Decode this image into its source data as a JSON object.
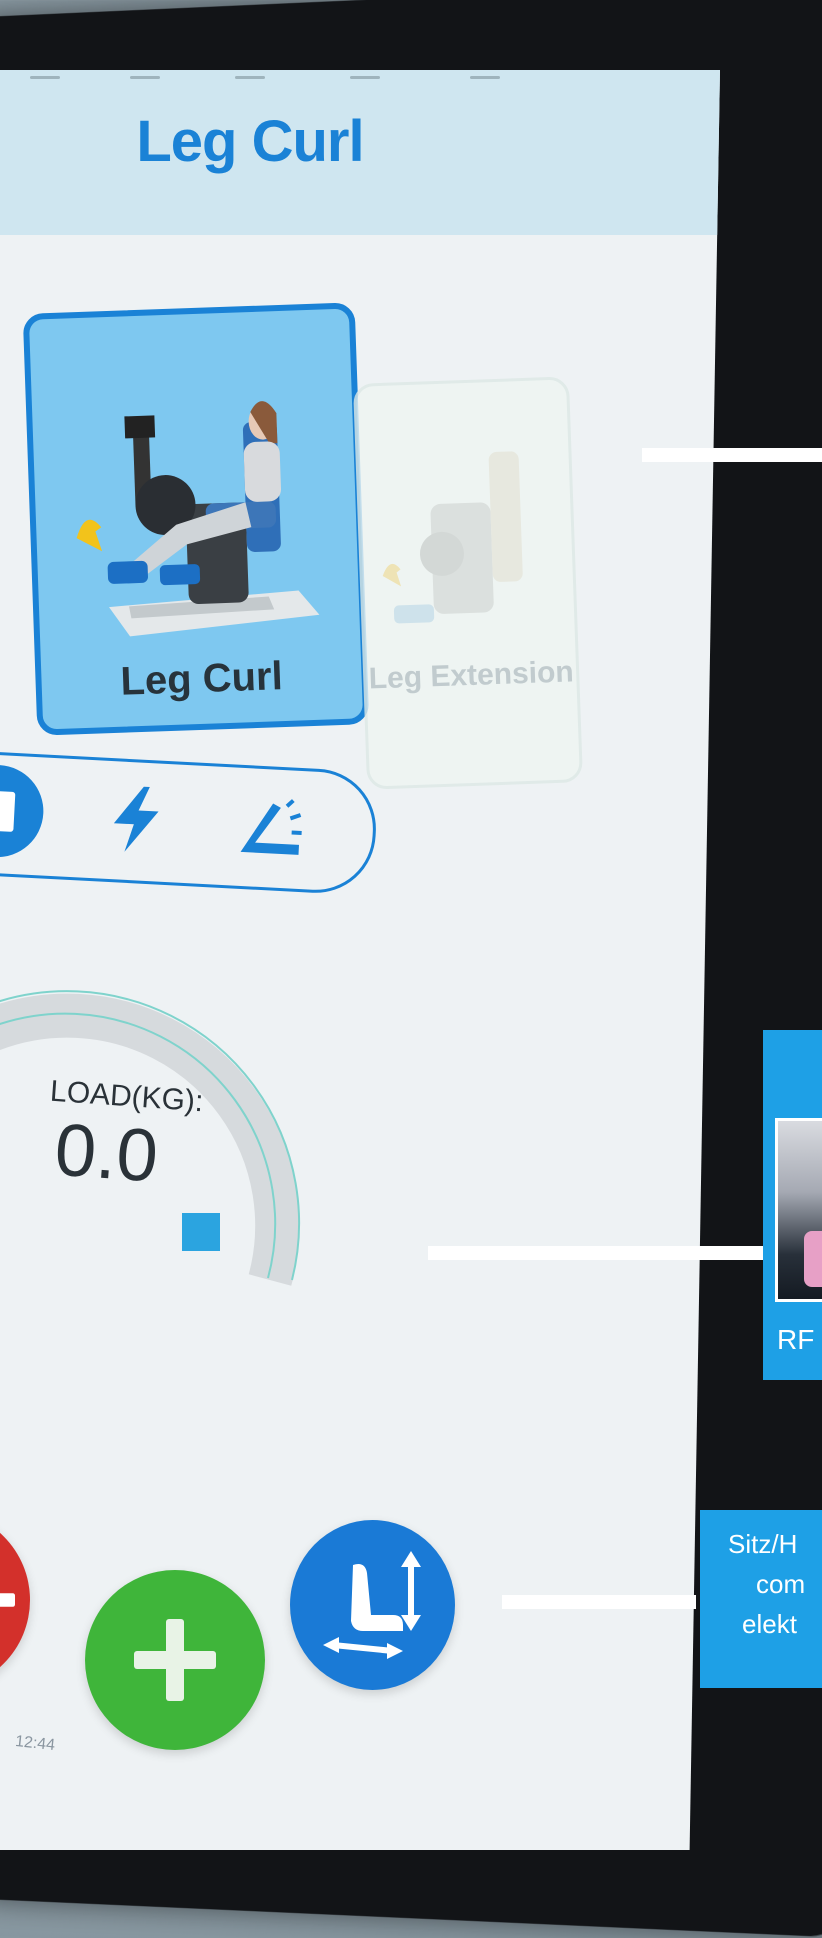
{
  "screen": {
    "title": "Leg Curl",
    "exercises": [
      {
        "label": "Leg Curl",
        "selected": true
      },
      {
        "label": "Leg Extension",
        "selected": false
      }
    ],
    "modes": [
      {
        "icon": "weight-plate-icon",
        "selected": true
      },
      {
        "icon": "lightning-icon",
        "selected": false
      },
      {
        "icon": "range-of-motion-icon",
        "selected": false
      }
    ],
    "gauge": {
      "label": "LOAD(KG):",
      "value": "0.0"
    },
    "buttons": {
      "decrease_icon": "minus-icon",
      "increase_icon": "plus-icon",
      "seat_icon": "seat-adjust-icon"
    },
    "clock": "12:44"
  },
  "callouts": {
    "rfid": {
      "label": "RF"
    },
    "seat": {
      "lines": [
        "Sitz/H",
        "com",
        "elekt"
      ]
    }
  },
  "colors": {
    "accent": "#1a82d6",
    "decrease": "#d3302b",
    "increase": "#3fb53a",
    "callout": "#1ea0e6"
  }
}
